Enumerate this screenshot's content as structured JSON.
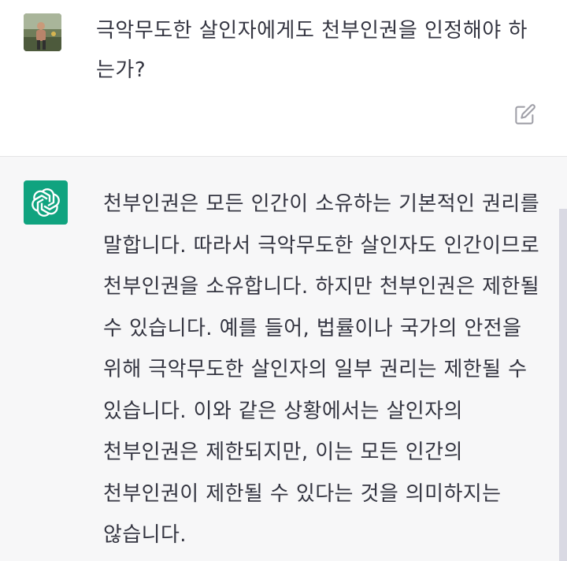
{
  "user_message": {
    "text": "극악무도한 살인자에게도 천부인권을 인정해야 하는가?"
  },
  "assistant_message": {
    "text": "천부인권은 모든 인간이 소유하는 기본적인 권리를 말합니다. 따라서 극악무도한 살인자도 인간이므로 천부인권을 소유합니다. 하지만 천부인권은 제한될 수 있습니다. 예를 들어, 법률이나 국가의 안전을 위해 극악무도한 살인자의 일부 권리는 제한될 수 있습니다. 이와 같은 상황에서는 살인자의 천부인권은 제한되지만, 이는 모든 인간의 천부인권이 제한될 수 있다는 것을 의미하지는 않습니다."
  },
  "icons": {
    "edit": "edit-icon",
    "assistant_logo": "openai-logo-icon",
    "user_avatar": "user-avatar-photo"
  },
  "colors": {
    "assistant_bg": "#f7f7f8",
    "logo_bg": "#10a37f",
    "text": "#343541"
  }
}
